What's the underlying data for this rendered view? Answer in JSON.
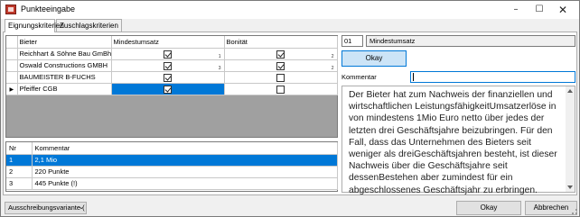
{
  "window": {
    "title": "Punkteeingabe"
  },
  "tabs": [
    {
      "label": "Eignungskriterien",
      "active": true
    },
    {
      "label": "Zuschlagskriterien",
      "active": false
    }
  ],
  "bidders_grid": {
    "columns": [
      "Bieter",
      "Mindestumsatz",
      "Bonität"
    ],
    "rows": [
      {
        "bieter": "Reichhart & Söhne Bau GmBh",
        "mindestumsatz": true,
        "mindestumsatz_idx": "1",
        "bonitaet": true,
        "bonitaet_idx": "2",
        "current": false
      },
      {
        "bieter": "Oswald Constructions GMBH",
        "mindestumsatz": true,
        "mindestumsatz_idx": "3",
        "bonitaet": true,
        "bonitaet_idx": "2",
        "current": false
      },
      {
        "bieter": "BAUMEISTER B-FUCHS",
        "mindestumsatz": true,
        "mindestumsatz_idx": "",
        "bonitaet": false,
        "bonitaet_idx": "",
        "current": false
      },
      {
        "bieter": "Pfeiffer CGB",
        "mindestumsatz": true,
        "mindestumsatz_idx": "",
        "bonitaet": false,
        "bonitaet_idx": "",
        "current": true
      }
    ]
  },
  "points_grid": {
    "columns": [
      "Nr",
      "Kommentar"
    ],
    "rows": [
      {
        "nr": "1",
        "kommentar": "2,1 Mio",
        "selected": true
      },
      {
        "nr": "2",
        "kommentar": "220 Punkte",
        "selected": false
      },
      {
        "nr": "3",
        "kommentar": "445 Punkte (!)",
        "selected": false
      }
    ]
  },
  "criterion": {
    "number": "01",
    "name": "Mindestumsatz",
    "okay_label": "Okay",
    "comment_label": "Kommentar",
    "comment_value": "",
    "description": "Der Bieter hat zum Nachweis der finanziellen und wirtschaftlichen LeistungsfähigkeitUmsatzerlöse in von mindestens 1Mio Euro netto über jedes der letzten drei Geschäftsjahre beizubringen. Für den Fall, dass das Unternehmen des Bieters seit weniger als dreiGeschäftsjahren besteht, ist dieser Nachweis über die Geschäftsjahre seit dessenBestehen aber zumindest für ein abgeschlossenes Geschäftsjahr zu erbringen."
  },
  "footer": {
    "variant_select": "Ausschreibungsvariante (",
    "ok_label": "Okay",
    "cancel_label": "Abbrechen"
  },
  "colors": {
    "selection": "#0078d7",
    "button_focus_bg": "#cce4f7"
  }
}
